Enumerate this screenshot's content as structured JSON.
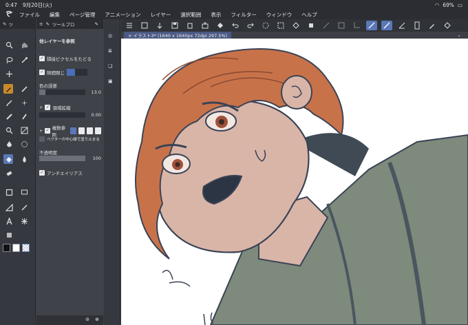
{
  "status": {
    "time": "0:47",
    "date": "9月20日(火)",
    "battery": "69%"
  },
  "menu": [
    "ファイル",
    "編集",
    "ページ管理",
    "アニメーション",
    "レイヤー",
    "選択範囲",
    "表示",
    "フィルター",
    "ウィンドウ",
    "ヘルプ"
  ],
  "subtool": {
    "header": "ツールプロ"
  },
  "properties": {
    "ref_layer_label": "他レイヤーを参照",
    "adjacent_pixel": "隣接ピクセルをたどる",
    "close_gap": "隙間閉じ",
    "color_margin_label": "色の誤差",
    "color_margin_value": "13.0",
    "area_scaling": "領域拡縮",
    "area_scaling_value": "0.00",
    "multi_ref": "複数参照",
    "vector_center": "ベクターの中心線で塗り止まる",
    "opacity_label": "不透明度",
    "opacity_value": "100",
    "antialias": "アンチエイリアス"
  },
  "canvas": {
    "tab_label": "× イラスト3* (1640 x 1640px 72dpi 297.5%)"
  },
  "colors": {
    "accent": "#5a78b8",
    "hair": "#c8724a",
    "skin": "#d9b5a8",
    "shirt": "#7d8a7c",
    "line": "#3a4355"
  }
}
